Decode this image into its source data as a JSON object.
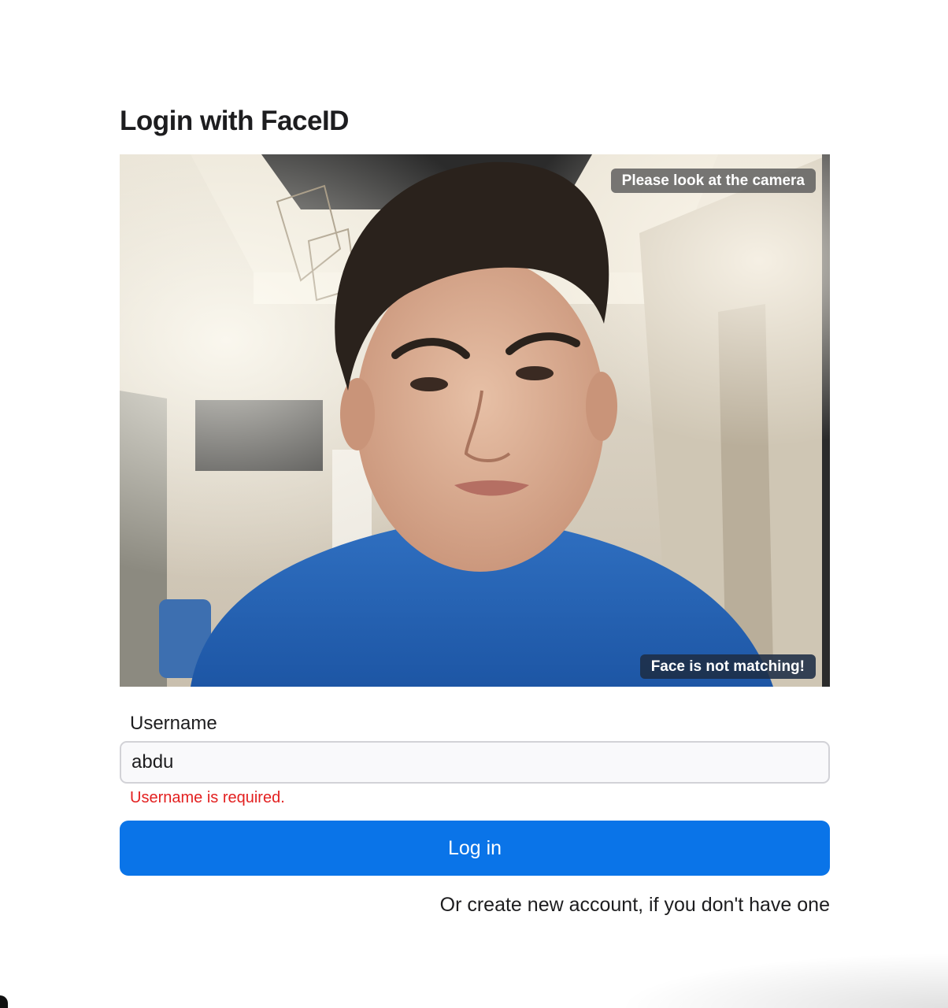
{
  "page": {
    "title": "Login with FaceID"
  },
  "camera": {
    "prompt_overlay": "Please look at the camera",
    "status_overlay": "Face is not matching!",
    "status_color": "#1e2d46"
  },
  "form": {
    "username_label": "Username",
    "username_value": "abdu",
    "username_error": "Username is required.",
    "error_color": "#e32020",
    "login_button_label": "Log in",
    "accent_color": "#0a74e8",
    "create_account_link": "Or create new account, if you don't have one"
  }
}
